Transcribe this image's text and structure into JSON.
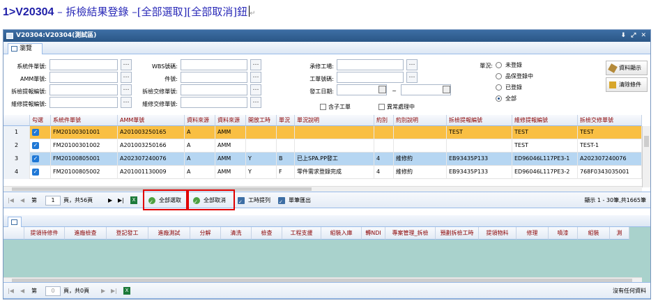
{
  "doc_title": {
    "code": "1>V20304",
    "rest": " – 拆檢結果登錄 –[全部選取][全部取消]鈕",
    "mark": "↵"
  },
  "window": {
    "title": "V20304:V20304(測試區)",
    "controls": "⬇ ⤢ ✕",
    "tab": "瀏覽"
  },
  "form": {
    "labels": {
      "sys_part": "系統件單號:",
      "amm": "AMM單號:",
      "disassembly_ref": "拆檢提報編號:",
      "maint_ref": "維修提報編號:",
      "wbs": "WBS號碼:",
      "part_no": "件號:",
      "disassembly_handover": "拆檢交修單號:",
      "maint_handover": "維修交修單號:",
      "contractor": "承修工場:",
      "work_order": "工單號碼:",
      "start_date": "發工日期:",
      "status": "單況:"
    },
    "date_sep": "~",
    "checks": {
      "sub_order": "含子工單",
      "abnormal": "異常處理中"
    },
    "status_options": [
      "未登錄",
      "品保登錄中",
      "已登錄",
      "全部"
    ],
    "status_selected": "全部",
    "buttons": {
      "show": "資料顯示",
      "clear": "清除條件"
    }
  },
  "grid": {
    "headers": [
      "",
      "勾選",
      "系統件單號",
      "AMM單號",
      "資料來源",
      "資料來源",
      "開放工時",
      "單況",
      "單況說明",
      "約別",
      "約別說明",
      "拆檢提報編號",
      "維修提報編號",
      "拆檢交修單號"
    ],
    "rows": [
      {
        "no": "1",
        "checked": true,
        "sys": "FM20100301001",
        "amm": "A201003250165",
        "src1": "A",
        "src2": "AMM",
        "open": "",
        "status": "",
        "status_desc": "",
        "contract": "",
        "contract_desc": "",
        "dis_ref": "TEST",
        "maint_ref": "TEST",
        "handover": "TEST"
      },
      {
        "no": "2",
        "checked": true,
        "sys": "FM20100301002",
        "amm": "A201003250166",
        "src1": "A",
        "src2": "AMM",
        "open": "",
        "status": "",
        "status_desc": "",
        "contract": "",
        "contract_desc": "",
        "dis_ref": "",
        "maint_ref": "TEST",
        "handover": "TEST-1"
      },
      {
        "no": "3",
        "checked": true,
        "sys": "FM20100805001",
        "amm": "A202307240076",
        "src1": "A",
        "src2": "AMM",
        "open": "Y",
        "status": "B",
        "status_desc": "已上SPA.PP發工",
        "contract": "4",
        "contract_desc": "維修約",
        "dis_ref": "EB93435P133",
        "maint_ref": "ED96046L117PE3-1",
        "handover": "A202307240076"
      },
      {
        "no": "4",
        "checked": true,
        "sys": "FM20100805002",
        "amm": "A201001130009",
        "src1": "A",
        "src2": "AMM",
        "open": "Y",
        "status": "F",
        "status_desc": "零件需求登錄完成",
        "contract": "4",
        "contract_desc": "維修約",
        "dis_ref": "EB93435P133",
        "maint_ref": "ED96046L117PE3-2",
        "handover": "768F0343035001"
      }
    ]
  },
  "pager1": {
    "page_prefix": "第",
    "page": "1",
    "page_suffix": "頁，共56頁",
    "select_all": "全部選取",
    "cancel_all": "全部取消",
    "work_list": "工時提列",
    "export": "單筆匯出",
    "summary": "顯示 1 - 30筆,共1665筆"
  },
  "grid2": {
    "headers": [
      "提領待修件",
      "進廠檢查",
      "登記發工",
      "進廠測試",
      "分解",
      "清洗",
      "檢查",
      "工程支援",
      "組裝入庫",
      "轉NDI",
      "專案管理_拆檢",
      "預劃拆檢工時",
      "提領物料",
      "修理",
      "噴漆",
      "組裝",
      "測"
    ]
  },
  "pager2": {
    "page_prefix": "第",
    "page": "0",
    "page_suffix": "頁，共0頁",
    "summary": "沒有任何資料"
  },
  "colors": {
    "selected_row": "#f9bf43",
    "highlight_row": "#b6d6f2",
    "accent": "#2a5686",
    "empty_grid": "#a9d2cc"
  }
}
